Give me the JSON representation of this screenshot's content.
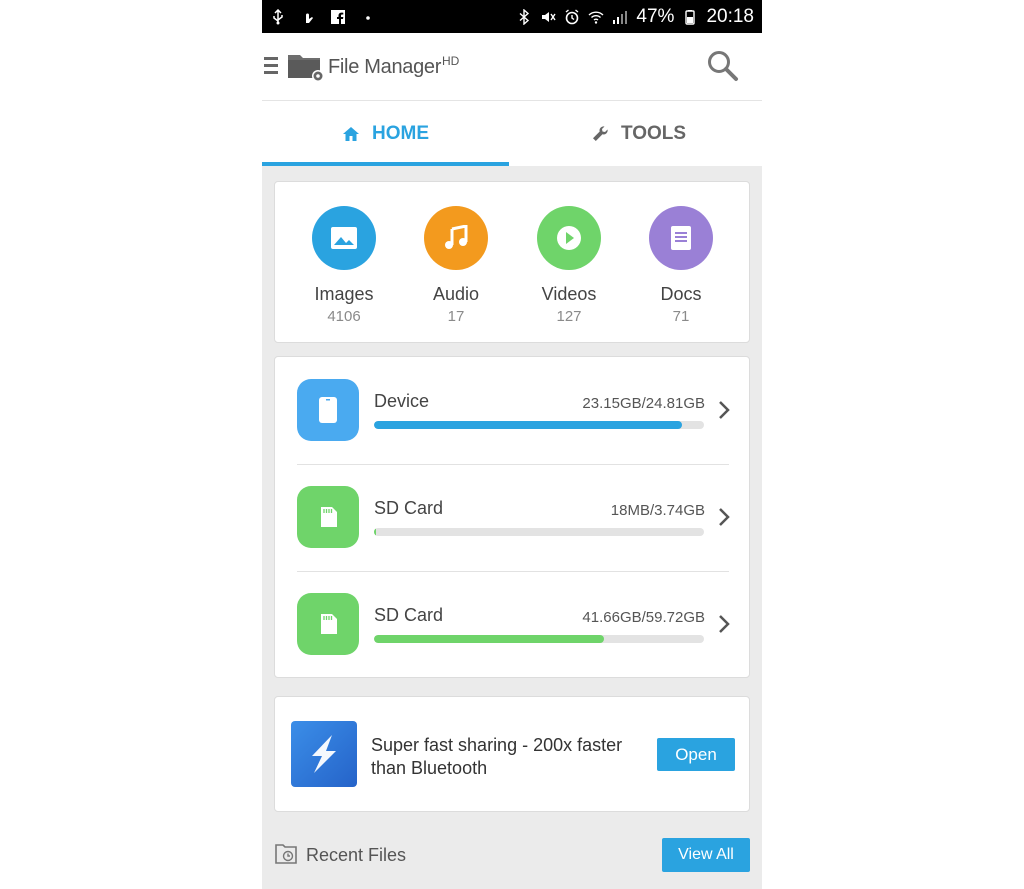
{
  "status_bar": {
    "battery": "47%",
    "time": "20:18",
    "left_icons": [
      "usb-icon",
      "gesture-icon",
      "facebook-icon",
      "dot-icon"
    ],
    "right_icons": [
      "bluetooth-icon",
      "mute-icon",
      "alarm-icon",
      "wifi-icon",
      "signal-icon",
      "battery-icon"
    ]
  },
  "app_bar": {
    "title": "File Manager",
    "title_suffix": "HD",
    "icons": [
      "menu-icon",
      "folder-gear-icon",
      "search-icon"
    ]
  },
  "tabs": [
    {
      "label": "HOME",
      "icon": "home-icon",
      "active": true
    },
    {
      "label": "TOOLS",
      "icon": "wrench-icon",
      "active": false
    }
  ],
  "categories": [
    {
      "label": "Images",
      "count": "4106",
      "color": "#2aa3e0",
      "icon": "image-icon"
    },
    {
      "label": "Audio",
      "count": "17",
      "color": "#f39a1e",
      "icon": "music-icon"
    },
    {
      "label": "Videos",
      "count": "127",
      "color": "#6fd46a",
      "icon": "play-icon"
    },
    {
      "label": "Docs",
      "count": "71",
      "color": "#9a80d6",
      "icon": "document-icon"
    }
  ],
  "storage": [
    {
      "name": "Device",
      "usage": "23.15GB/24.81GB",
      "fill_fraction": 0.933,
      "color": "#2aa3e0",
      "icon_bg": "#4aaaf0",
      "icon": "phone-icon"
    },
    {
      "name": "SD Card",
      "usage": "18MB/3.74GB",
      "fill_fraction": 0.005,
      "color": "#6fd46a",
      "icon_bg": "#6fd46a",
      "icon": "sd-card-icon"
    },
    {
      "name": "SD Card",
      "usage": "41.66GB/59.72GB",
      "fill_fraction": 0.698,
      "color": "#6fd46a",
      "icon_bg": "#6fd46a",
      "icon": "sd-card-icon"
    }
  ],
  "promo": {
    "text": "Super fast sharing - 200x faster than Bluetooth",
    "button": "Open",
    "icon": "shareit-icon"
  },
  "recent": {
    "label": "Recent Files",
    "button": "View All",
    "icon": "clock-folder-icon"
  },
  "colors": {
    "accent": "#2aa3e0",
    "background": "#ebebeb"
  }
}
